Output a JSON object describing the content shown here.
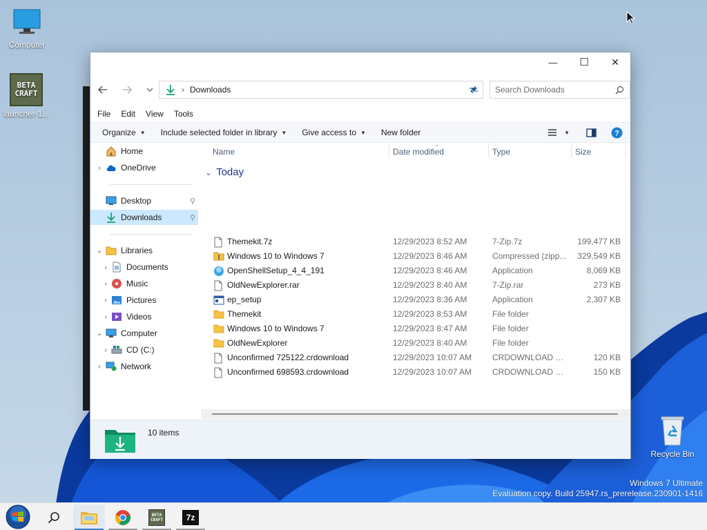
{
  "desktop": {
    "icons": [
      {
        "label": "Computer"
      },
      {
        "label": "launcher-1..."
      },
      {
        "label": "Recycle Bin"
      }
    ],
    "minecraft_logo_text": [
      "BETA",
      "CRAFT"
    ],
    "watermark": {
      "line1": "Windows 7 Ultimate",
      "line2": "Evaluation copy. Build 25947.rs_prerelease.230901-1416"
    }
  },
  "window": {
    "title_buttons": {
      "minimize": "—",
      "maximize": "☐",
      "close": "✕"
    },
    "address": {
      "location": "Downloads"
    },
    "search": {
      "placeholder": "Search Downloads"
    },
    "menu": [
      "File",
      "Edit",
      "View",
      "Tools"
    ],
    "commands": {
      "organize": "Organize",
      "include": "Include selected folder in library",
      "share": "Give access to",
      "new_folder": "New folder"
    },
    "nav": {
      "home": "Home",
      "onedrive": "OneDrive",
      "desktop": "Desktop",
      "downloads": "Downloads",
      "libraries": "Libraries",
      "documents": "Documents",
      "music": "Music",
      "pictures": "Pictures",
      "videos": "Videos",
      "computer": "Computer",
      "drive_c": "CD (C:)",
      "network": "Network"
    },
    "columns": {
      "name": "Name",
      "date": "Date modified",
      "type": "Type",
      "size": "Size"
    },
    "group": "Today",
    "files": [
      {
        "name": "Themekit.7z",
        "date": "12/29/2023 8:52 AM",
        "type": "7-Zip.7z",
        "size": "199,477 KB",
        "icon": "file-icon"
      },
      {
        "name": "Windows 10 to Windows 7",
        "date": "12/29/2023 8:46 AM",
        "type": "Compressed (zipp...",
        "size": "329,549 KB",
        "icon": "zip-folder-icon"
      },
      {
        "name": "OpenShellSetup_4_4_191",
        "date": "12/29/2023 8:46 AM",
        "type": "Application",
        "size": "8,069 KB",
        "icon": "openshell-icon"
      },
      {
        "name": "OldNewExplorer.rar",
        "date": "12/29/2023 8:40 AM",
        "type": "7-Zip.rar",
        "size": "273 KB",
        "icon": "file-icon"
      },
      {
        "name": "ep_setup",
        "date": "12/29/2023 8:36 AM",
        "type": "Application",
        "size": "2,307 KB",
        "icon": "app-icon"
      },
      {
        "name": "Themekit",
        "date": "12/29/2023 8:53 AM",
        "type": "File folder",
        "size": "",
        "icon": "folder-icon"
      },
      {
        "name": "Windows 10 to Windows 7",
        "date": "12/29/2023 8:47 AM",
        "type": "File folder",
        "size": "",
        "icon": "folder-icon"
      },
      {
        "name": "OldNewExplorer",
        "date": "12/29/2023 8:40 AM",
        "type": "File folder",
        "size": "",
        "icon": "folder-icon"
      },
      {
        "name": "Unconfirmed 725122.crdownload",
        "date": "12/29/2023 10:07 AM",
        "type": "CRDOWNLOAD File",
        "size": "120 KB",
        "icon": "file-icon"
      },
      {
        "name": "Unconfirmed 698593.crdownload",
        "date": "12/29/2023 10:07 AM",
        "type": "CRDOWNLOAD File",
        "size": "150 KB",
        "icon": "file-icon"
      }
    ],
    "status": {
      "item_count": "10 items"
    }
  },
  "taskbar": {
    "items": [
      "start-orb-icon",
      "search-icon",
      "explorer-icon",
      "chrome-icon",
      "betacraft-icon",
      "7zip-icon"
    ],
    "sevenzip_label": "7z"
  },
  "colors": {
    "accent": "#0078d4",
    "selection": "#cce8ff",
    "folder": "#f6c343",
    "download_green": "#1aa06d"
  }
}
